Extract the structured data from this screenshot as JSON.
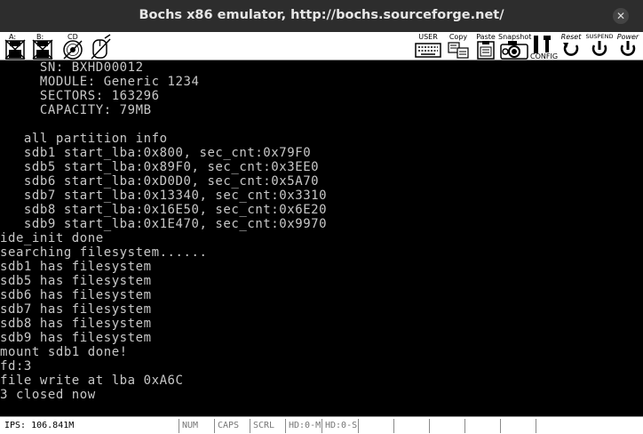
{
  "window": {
    "title": "Bochs x86 emulator, http://bochs.sourceforge.net/",
    "close_glyph": "✕"
  },
  "toolbar": {
    "floppy_a_label": "A:",
    "floppy_b_label": "B:",
    "cdrom_label": "CD",
    "user_label": "USER",
    "copy_label": "Copy",
    "paste_label": "Paste",
    "snapshot_label": "Snapshot",
    "config_label": "CONFIG",
    "reset_label": "Reset",
    "suspend_label": "SUSPEND",
    "power_label": "Power"
  },
  "console": {
    "lines": [
      "     SN: BXHD00012",
      "     MODULE: Generic 1234",
      "     SECTORS: 163296",
      "     CAPACITY: 79MB",
      "",
      "   all partition info",
      "   sdb1 start_lba:0x800, sec_cnt:0x79F0",
      "   sdb5 start_lba:0x89F0, sec_cnt:0x3EE0",
      "   sdb6 start_lba:0xD0D0, sec_cnt:0x5A70",
      "   sdb7 start_lba:0x13340, sec_cnt:0x3310",
      "   sdb8 start_lba:0x16E50, sec_cnt:0x6E20",
      "   sdb9 start_lba:0x1E470, sec_cnt:0x9970",
      "ide_init done",
      "searching filesystem......",
      "sdb1 has filesystem",
      "sdb5 has filesystem",
      "sdb6 has filesystem",
      "sdb7 has filesystem",
      "sdb8 has filesystem",
      "sdb9 has filesystem",
      "mount sdb1 done!",
      "fd:3",
      "file write at lba 0xA6C",
      "3 closed now"
    ]
  },
  "statusbar": {
    "ips": "IPS: 106.841M",
    "num": "NUM",
    "caps": "CAPS",
    "scrl": "SCRL",
    "hd0m": "HD:0-M",
    "hd0s": "HD:0-S"
  },
  "colors": {
    "console_bg": "#000000",
    "console_fg": "#c8c8c8",
    "titlebar_bg": "#2d2d2d"
  }
}
